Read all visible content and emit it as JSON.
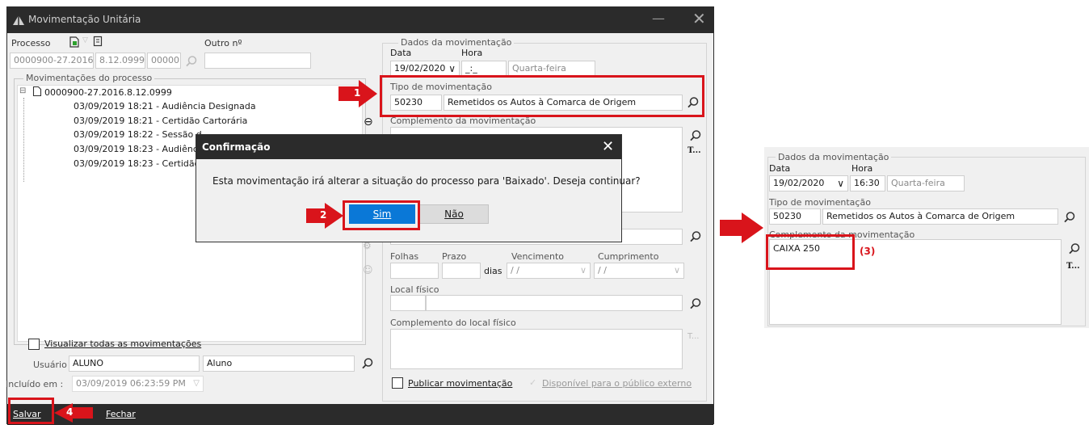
{
  "window": {
    "title": "Movimentação Unitária",
    "processo_label": "Processo",
    "outro_label": "Outro nº",
    "processo_num": "0000900-27.2016",
    "processo_orgao": "8.12.0999",
    "processo_code": "00000",
    "movs_group_label": "Movimentações do processo",
    "tree_root": "0000900-27.2016.8.12.0999",
    "tree_items": [
      "03/09/2019 18:21 - Audiência Designada",
      "03/09/2019 18:21 - Certidão Cartorária",
      "03/09/2019 18:22 - Sessão d",
      "03/09/2019 18:23 - Audiênci",
      "03/09/2019 18:23 - Certidão"
    ],
    "view_all_label": "Visualizar todas as movimentações",
    "usuario_label": "Usuário",
    "usuario_login": "ALUNO",
    "usuario_name": "Aluno",
    "incluido_label": "Incluído em :",
    "incluido_value": "03/09/2019 06:23:59 PM",
    "dados_label": "Dados da movimentação",
    "data_label": "Data",
    "hora_label": "Hora",
    "data_value": "19/02/2020",
    "hora_value": "_:_",
    "weekday": "Quarta-feira",
    "tipo_label": "Tipo de movimentação",
    "tipo_code": "50230",
    "tipo_desc": "Remetidos os Autos à Comarca de Origem",
    "complemento_label": "Complemento da movimentação",
    "folhas_label": "Folhas",
    "prazo_label": "Prazo",
    "vencimento_label": "Vencimento",
    "cumprimento_label": "Cumprimento",
    "dias_label": "dias",
    "date_placeholder": "/ /",
    "local_label": "Local físico",
    "comp_local_label": "Complemento do local físico",
    "publicar_label": "Publicar movimentação",
    "disponivel_label": "Disponível para o público externo",
    "salvar_label": "Salvar",
    "fechar_label": "Fechar",
    "text_btn": "T..."
  },
  "dialog": {
    "title": "Confirmação",
    "message": "Esta movimentação irá alterar a situação do processo para 'Baixado'. Deseja continuar?",
    "yes_label": "Sim",
    "no_label": "Não"
  },
  "annotations": {
    "step1": "1",
    "step2": "2",
    "step3": "(3)",
    "step4": "4"
  },
  "inset": {
    "dados_label": "Dados da movimentação",
    "data_label": "Data",
    "hora_label": "Hora",
    "data_value": "19/02/2020",
    "hora_value": "16:30",
    "weekday": "Quarta-feira",
    "tipo_label": "Tipo de movimentação",
    "tipo_code": "50230",
    "tipo_desc": "Remetidos os Autos à Comarca de Origem",
    "complemento_label": "Complemento da movimentação",
    "complemento_value": "CAIXA 250",
    "text_btn": "T..."
  },
  "colors": {
    "accent": "#0a78d7",
    "annotation_red": "#d9141b",
    "titlebar": "#2b2b2b"
  }
}
